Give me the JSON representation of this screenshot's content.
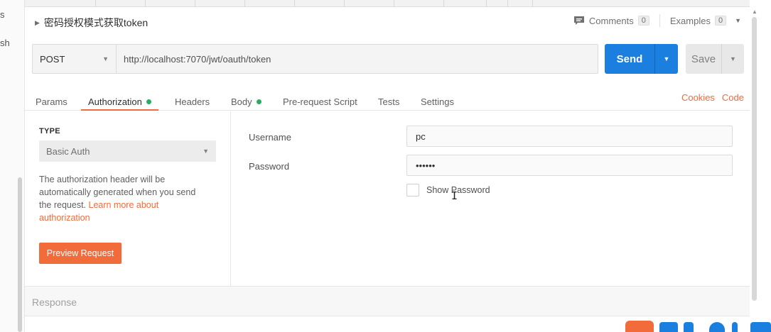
{
  "sidebar": {
    "fragments": [
      "s",
      "sh"
    ]
  },
  "request": {
    "title": "密码授权模式获取token",
    "comments_label": "Comments",
    "comments_count": "0",
    "examples_label": "Examples",
    "examples_count": "0",
    "method": "POST",
    "url": "http://localhost:7070/jwt/oauth/token",
    "send_label": "Send",
    "save_label": "Save"
  },
  "tabs": [
    {
      "label": "Params",
      "dot": false,
      "active": false
    },
    {
      "label": "Authorization",
      "dot": true,
      "active": true
    },
    {
      "label": "Headers",
      "dot": false,
      "active": false
    },
    {
      "label": "Body",
      "dot": true,
      "active": false
    },
    {
      "label": "Pre-request Script",
      "dot": false,
      "active": false
    },
    {
      "label": "Tests",
      "dot": false,
      "active": false
    },
    {
      "label": "Settings",
      "dot": false,
      "active": false
    }
  ],
  "tab_links": {
    "cookies": "Cookies",
    "code": "Code"
  },
  "auth": {
    "type_label": "TYPE",
    "type_value": "Basic Auth",
    "description_prefix": "The authorization header will be automatically generated when you send the request. ",
    "learn_more": "Learn more about authorization",
    "preview_label": "Preview Request",
    "username_label": "Username",
    "username_value": "pc",
    "password_label": "Password",
    "password_value": "••••••",
    "show_password_label": "Show Password"
  },
  "response": {
    "label": "Response"
  },
  "icons": {
    "comment": "comment-icon",
    "chevron": "chevron-down-icon",
    "cursor": "text-cursor-icon"
  },
  "colors": {
    "accent": "#f26b3a",
    "primary": "#1b7fe0",
    "dot": "#27ae60"
  }
}
